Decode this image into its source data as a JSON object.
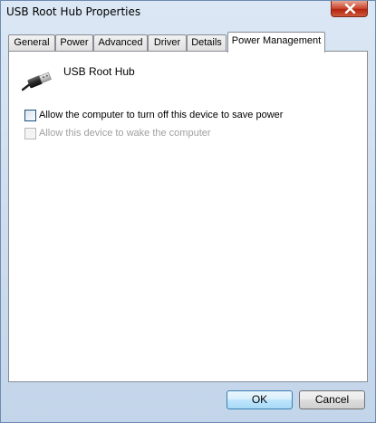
{
  "window": {
    "title": "USB Root Hub Properties"
  },
  "tabs": [
    {
      "label": "General"
    },
    {
      "label": "Power"
    },
    {
      "label": "Advanced"
    },
    {
      "label": "Driver"
    },
    {
      "label": "Details"
    },
    {
      "label": "Power Management",
      "active": true
    }
  ],
  "device": {
    "name": "USB Root Hub",
    "icon": "usb-plug-icon"
  },
  "options": [
    {
      "label": "Allow the computer to turn off this device to save power",
      "checked": false,
      "enabled": true
    },
    {
      "label": "Allow this device to wake the computer",
      "checked": false,
      "enabled": false
    }
  ],
  "buttons": {
    "ok": "OK",
    "cancel": "Cancel"
  }
}
